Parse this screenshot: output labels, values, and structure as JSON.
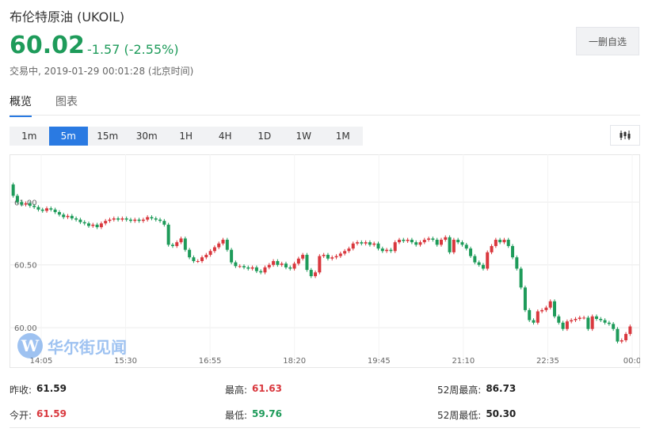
{
  "header": {
    "title": "布伦特原油 (UKOIL)",
    "price": "60.02",
    "change": "-1.57 (-2.55%)",
    "status": "交易中, 2019-01-29 00:01:28 (北京时间)",
    "remove_watchlist": "一删自选"
  },
  "tabs": [
    {
      "label": "概览",
      "active": true
    },
    {
      "label": "图表",
      "active": false
    }
  ],
  "periods": [
    {
      "label": "1m",
      "active": false
    },
    {
      "label": "5m",
      "active": true
    },
    {
      "label": "15m",
      "active": false
    },
    {
      "label": "30m",
      "active": false
    },
    {
      "label": "1H",
      "active": false
    },
    {
      "label": "4H",
      "active": false
    },
    {
      "label": "1D",
      "active": false
    },
    {
      "label": "1W",
      "active": false
    },
    {
      "label": "1M",
      "active": false
    }
  ],
  "toolbar": {
    "chart_type_icon": "candlestick-icon"
  },
  "watermark": {
    "logo": "W",
    "text": "华尔街见闻"
  },
  "colors": {
    "up": "#d9383e",
    "down": "#1e9b5a",
    "accent": "#2a7ae2"
  },
  "stats": {
    "prev_close_label": "昨收:",
    "prev_close": "61.59",
    "high_label": "最高:",
    "high": "61.63",
    "week52_high_label": "52周最高:",
    "week52_high": "86.73",
    "open_label": "今开:",
    "open": "61.59",
    "low_label": "最低:",
    "low": "59.76",
    "week52_low_label": "52周最低:",
    "week52_low": "50.30"
  },
  "chart_data": {
    "type": "candlestick",
    "x_ticks": [
      "14:05",
      "15:30",
      "16:55",
      "18:20",
      "19:45",
      "21:10",
      "22:35",
      "00:0"
    ],
    "y_ticks": [
      "61.00",
      "60.50",
      "60.00"
    ],
    "ylim": [
      59.73,
      61.38
    ],
    "grid": true,
    "closes": [
      61.05,
      61.0,
      60.98,
      60.99,
      60.97,
      60.96,
      60.94,
      60.93,
      60.95,
      60.94,
      60.92,
      60.9,
      60.88,
      60.89,
      60.87,
      60.86,
      60.84,
      60.83,
      60.81,
      60.82,
      60.8,
      60.83,
      60.85,
      60.86,
      60.87,
      60.86,
      60.87,
      60.86,
      60.85,
      60.86,
      60.85,
      60.86,
      60.88,
      60.87,
      60.86,
      60.85,
      60.82,
      60.66,
      60.65,
      60.68,
      60.71,
      60.62,
      60.56,
      60.53,
      60.53,
      60.56,
      60.58,
      60.61,
      60.64,
      60.67,
      60.7,
      60.62,
      60.52,
      60.49,
      60.49,
      60.48,
      60.47,
      60.48,
      60.45,
      60.44,
      60.48,
      60.5,
      60.53,
      60.5,
      60.51,
      60.48,
      60.47,
      60.51,
      60.55,
      60.58,
      60.46,
      60.41,
      60.44,
      60.57,
      60.58,
      60.55,
      60.56,
      60.57,
      60.59,
      60.61,
      60.63,
      60.67,
      60.68,
      60.67,
      60.68,
      60.66,
      60.67,
      60.63,
      60.61,
      60.62,
      60.61,
      60.68,
      60.7,
      60.69,
      60.7,
      60.68,
      60.66,
      60.68,
      60.7,
      60.71,
      60.7,
      60.66,
      60.7,
      60.72,
      60.6,
      60.7,
      60.68,
      60.66,
      60.63,
      60.57,
      60.52,
      60.5,
      60.47,
      60.6,
      60.65,
      60.7,
      60.68,
      60.7,
      60.65,
      60.56,
      60.47,
      60.32,
      60.14,
      60.06,
      60.04,
      60.13,
      60.14,
      60.16,
      60.21,
      60.09,
      60.04,
      59.99,
      60.05,
      60.06,
      60.07,
      60.08,
      60.08,
      59.99,
      60.09,
      60.07,
      60.06,
      60.04,
      60.03,
      59.99,
      59.89,
      59.9,
      59.95,
      60.01
    ]
  }
}
